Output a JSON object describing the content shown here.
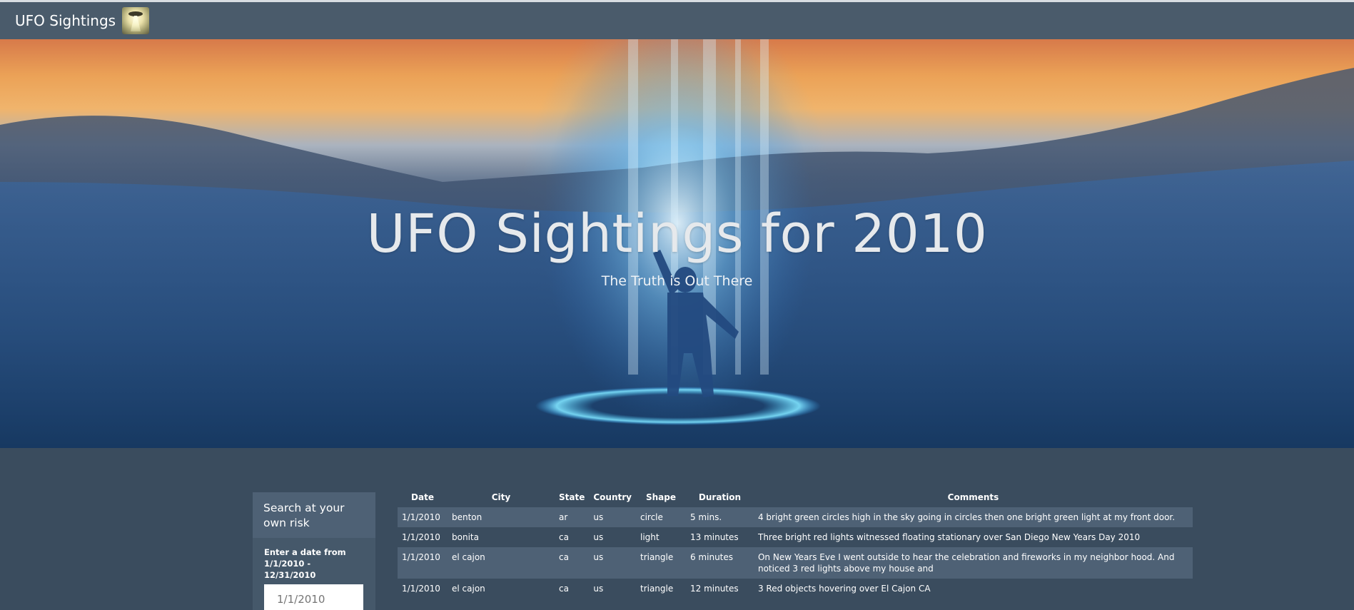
{
  "navbar": {
    "brand": "UFO Sightings",
    "logo_icon": "ufo-beam-icon"
  },
  "hero": {
    "title": "UFO Sightings for 2010",
    "subtitle": "The Truth is Out There"
  },
  "search": {
    "heading": "Search at your own risk",
    "label": "Enter a date from 1/1/2010 - 12/31/2010",
    "placeholder": "1/1/2010"
  },
  "table": {
    "columns": [
      "Date",
      "City",
      "State",
      "Country",
      "Shape",
      "Duration",
      "Comments"
    ],
    "rows": [
      {
        "date": "1/1/2010",
        "city": "benton",
        "state": "ar",
        "country": "us",
        "shape": "circle",
        "duration": "5 mins.",
        "comments": "4 bright green circles high in the sky going in circles then one bright green light at my front door."
      },
      {
        "date": "1/1/2010",
        "city": "bonita",
        "state": "ca",
        "country": "us",
        "shape": "light",
        "duration": "13 minutes",
        "comments": "Three bright red lights witnessed floating stationary over San Diego New Years Day 2010"
      },
      {
        "date": "1/1/2010",
        "city": "el cajon",
        "state": "ca",
        "country": "us",
        "shape": "triangle",
        "duration": "6 minutes",
        "comments": "On New Years Eve I went outside to hear the celebration and fireworks in my neighbor hood. And noticed 3 red lights above my house and"
      },
      {
        "date": "1/1/2010",
        "city": "el cajon",
        "state": "ca",
        "country": "us",
        "shape": "triangle",
        "duration": "12 minutes",
        "comments": "3 Red objects hovering over El Cajon CA"
      }
    ]
  },
  "colors": {
    "navbar": "#4a5b6b",
    "page_bg": "#3a4c5e",
    "row_alt": "#4e6175"
  }
}
